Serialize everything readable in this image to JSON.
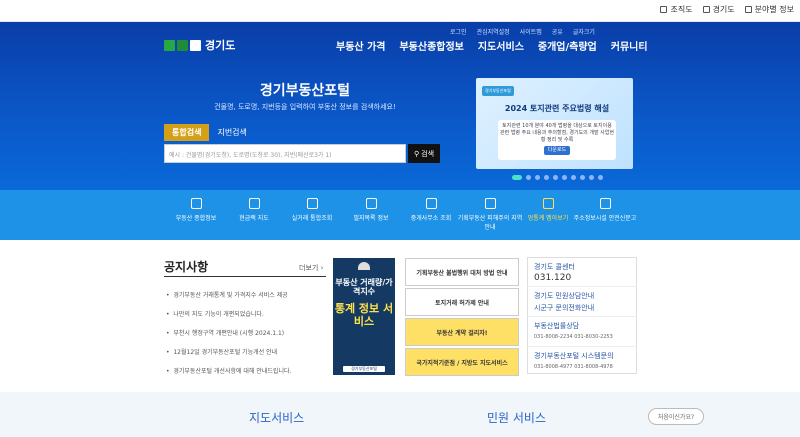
{
  "topbar": {
    "links": [
      "조직도",
      "경기도",
      "분야별 정보"
    ]
  },
  "header": {
    "logo_text": "경기도",
    "util_nav": [
      "로그인",
      "관심지역설정",
      "사이트맵",
      "공유",
      "글자크기"
    ],
    "main_nav": [
      "부동산 가격",
      "부동산종합정보",
      "지도서비스",
      "중개업/측량업",
      "커뮤니티"
    ]
  },
  "hero": {
    "title": "경기부동산포털",
    "subtitle": "건물명, 도로명, 지번등을 입력하여 부동산 정보를 검색하세요!",
    "tabs": [
      "통합검색",
      "지번검색"
    ],
    "search_placeholder": "예시 : 건물명(경기도청), 도로명(도청로 30), 지번(매산로3가 1)",
    "search_button": "검색"
  },
  "banner": {
    "badge": "경기부동산포털",
    "title": "2024 토지관련 주요법령 해설",
    "body": "토지관련 10개 분야 40개 법령을 대상으로 토지이용관련 법령 주요 내용과 주의할점, 경기도의 개발 사업현황 정리 및 수록",
    "link": "다운로드"
  },
  "quick_menu": [
    {
      "label": "부동산 종합정보"
    },
    {
      "label": "현금랙 지도"
    },
    {
      "label": "실거래 통합조회"
    },
    {
      "label": "필지목록 정보"
    },
    {
      "label": "중개사무소 조회"
    },
    {
      "label": "기획부동산 피해주의 지역안내"
    },
    {
      "label": "멍통계 맵아보기"
    },
    {
      "label": "주소정보시설 안전신문고"
    }
  ],
  "notices": {
    "title": "공지사항",
    "more": "더보기",
    "items": [
      "경기부동산 거래통계 및 가격지수 서비스 제공",
      "나만의 지도 기능이 개편되었습니다.",
      "부천시 행정구역 개편안내 (시행 2024.1.1)",
      "12월12일 경기부동산포털 기능개선 안내",
      "경기부동산포털 개선사항에 대해 안내드립니다."
    ]
  },
  "poster": {
    "line1": "부동산 거래량/가격지수",
    "line2": "통계 정보 서비스",
    "footer": "경기부동산포털"
  },
  "cards": [
    "기획부동산 불법행위 대처 방법 안내",
    "토지거래 허가제 안내",
    "부동산 계약 걸리자!",
    "국가지적기준점 / 지방도 지도서비스"
  ],
  "contact": {
    "callcenter_label": "경기도 콜센터",
    "callcenter_num": "031.120",
    "civil_label": "경기도 민원상담안내",
    "civil_sub": "시군구 문의전화안내",
    "law_label": "부동산법률상담",
    "law_nums": "031-8008-2234   031-8030-2253",
    "system_label": "경기부동산포털 시스템문의",
    "system_nums": "031-8008-4977   031-8008-4978"
  },
  "bottom": {
    "left_title": "지도서비스",
    "right_title": "민원 서비스",
    "faq": "처음이신가요?"
  },
  "colors": {
    "hero": "#0b57c8",
    "quick": "#1e92e6",
    "accent_tab": "#d4a017",
    "highlight": "#ffe14a"
  }
}
